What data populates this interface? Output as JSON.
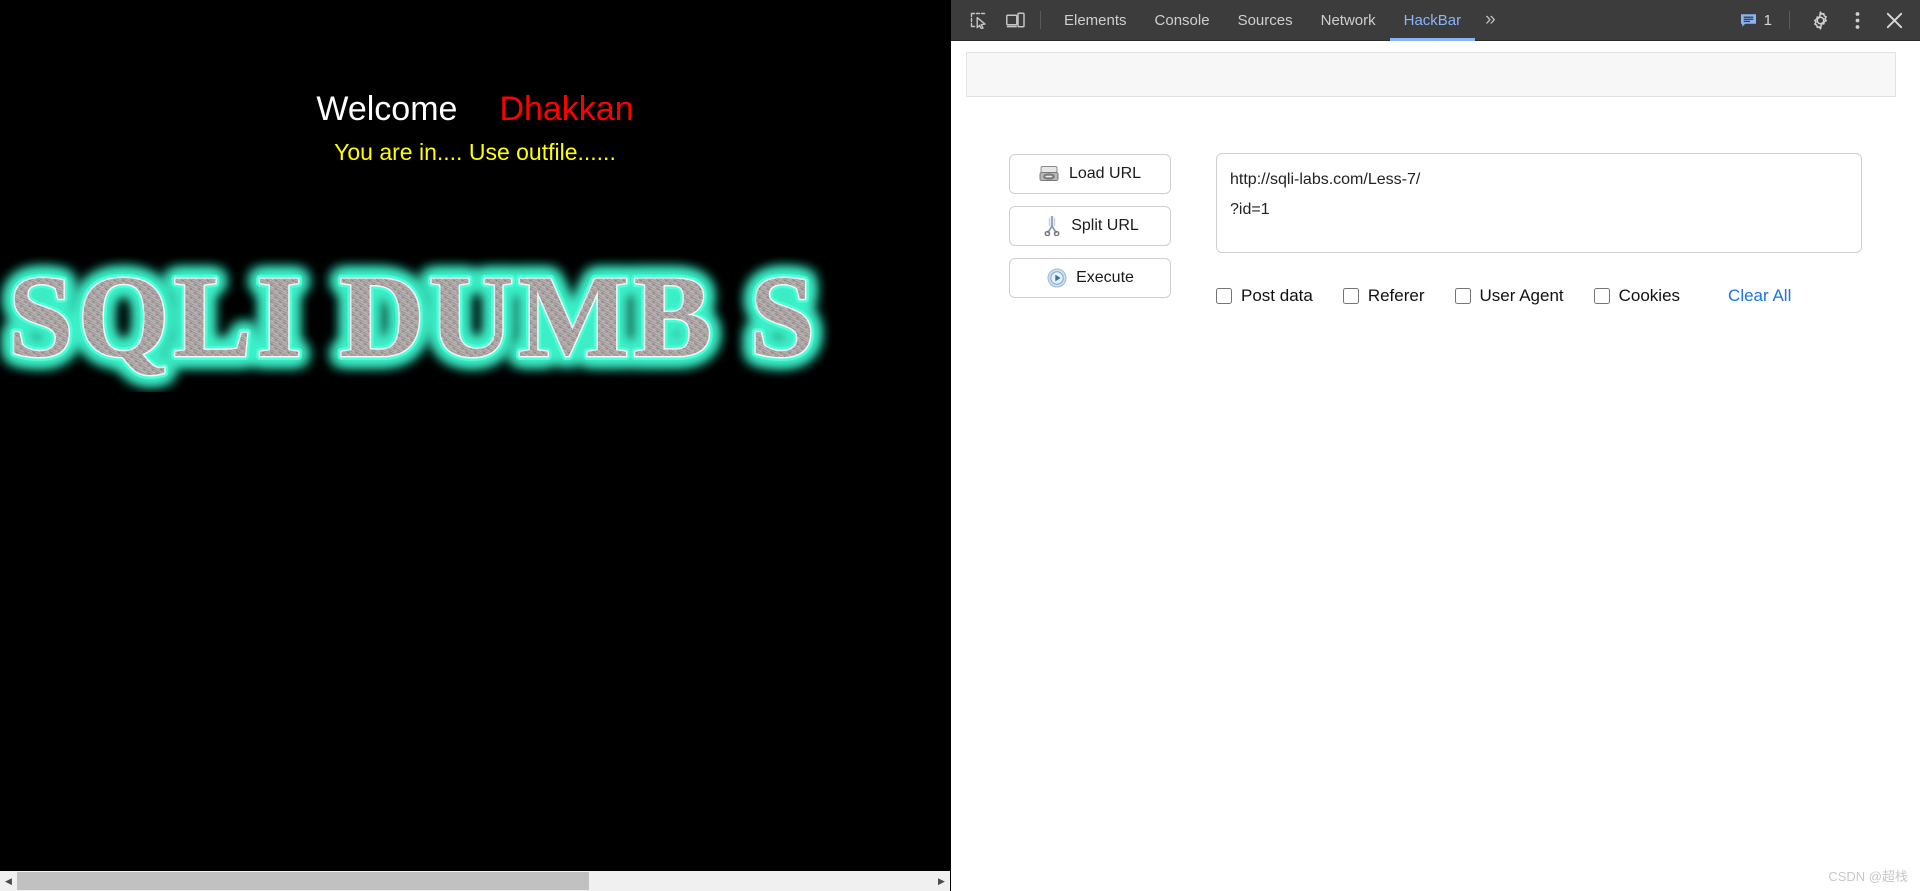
{
  "page": {
    "welcome_prefix": "Welcome",
    "welcome_name": "Dhakkan",
    "status_line": "You are in.... Use outfile......",
    "banner_text": "SQLI DUMB S",
    "colors": {
      "background": "#000000",
      "welcome": "#ffffff",
      "name": "#ff0000",
      "status": "#ffff00",
      "banner_glow": "#3ef0c8",
      "banner_fill": "#a9a2a2"
    },
    "scrollbar": {
      "left_arrow": "◀",
      "right_arrow": "▶"
    }
  },
  "devtools": {
    "icons": {
      "inspect": "inspect-element-icon",
      "device": "device-toolbar-icon",
      "messages": "console-message-icon",
      "settings": "gear-icon",
      "more_menu": "kebab-menu-icon",
      "close": "close-icon",
      "overflow_tabs": "»"
    },
    "tabs": [
      {
        "label": "Elements",
        "active": false
      },
      {
        "label": "Console",
        "active": false
      },
      {
        "label": "Sources",
        "active": false
      },
      {
        "label": "Network",
        "active": false
      },
      {
        "label": "HackBar",
        "active": true
      }
    ],
    "message_count": "1",
    "accent_color": "#8ab4f8",
    "tabbar_background": "#3c3c3c"
  },
  "hackbar": {
    "buttons": [
      {
        "label": "Load URL",
        "icon": "load-url-icon"
      },
      {
        "label": "Split URL",
        "icon": "split-url-icon"
      },
      {
        "label": "Execute",
        "icon": "execute-icon"
      }
    ],
    "url_value": "http://sqli-labs.com/Less-7/\n?id=1",
    "url_placeholder": "",
    "options": [
      {
        "label": "Post data",
        "checked": false
      },
      {
        "label": "Referer",
        "checked": false
      },
      {
        "label": "User Agent",
        "checked": false
      },
      {
        "label": "Cookies",
        "checked": false
      }
    ],
    "clear_all_label": "Clear All",
    "link_color": "#1a73e8"
  },
  "watermark": "CSDN @超栈"
}
